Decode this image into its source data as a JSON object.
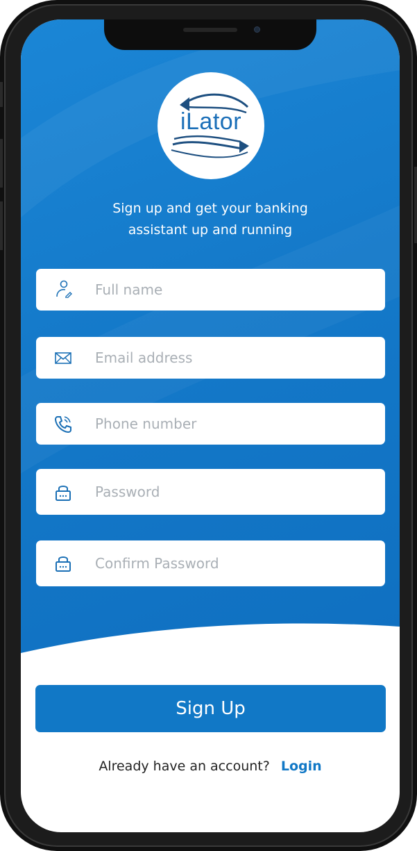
{
  "logo": {
    "text": "iLator"
  },
  "tagline": {
    "line1": "Sign up and get your banking",
    "line2": "assistant up and running"
  },
  "form": {
    "full_name": {
      "placeholder": "Full name",
      "icon": "user-edit-icon"
    },
    "email": {
      "placeholder": "Email address",
      "icon": "mail-icon"
    },
    "phone": {
      "placeholder": "Phone number",
      "icon": "phone-icon"
    },
    "password": {
      "placeholder": "Password",
      "icon": "lock-icon"
    },
    "confirm_password": {
      "placeholder": "Confirm Password",
      "icon": "lock-icon"
    }
  },
  "signup_button": {
    "label": "Sign Up"
  },
  "footer": {
    "prompt": "Already have an account?",
    "login_label": "Login"
  },
  "colors": {
    "primary_blue": "#1178c6",
    "background_blue": "#1479c9",
    "logo_text": "#1b6fb8",
    "placeholder": "#a9afb5"
  }
}
